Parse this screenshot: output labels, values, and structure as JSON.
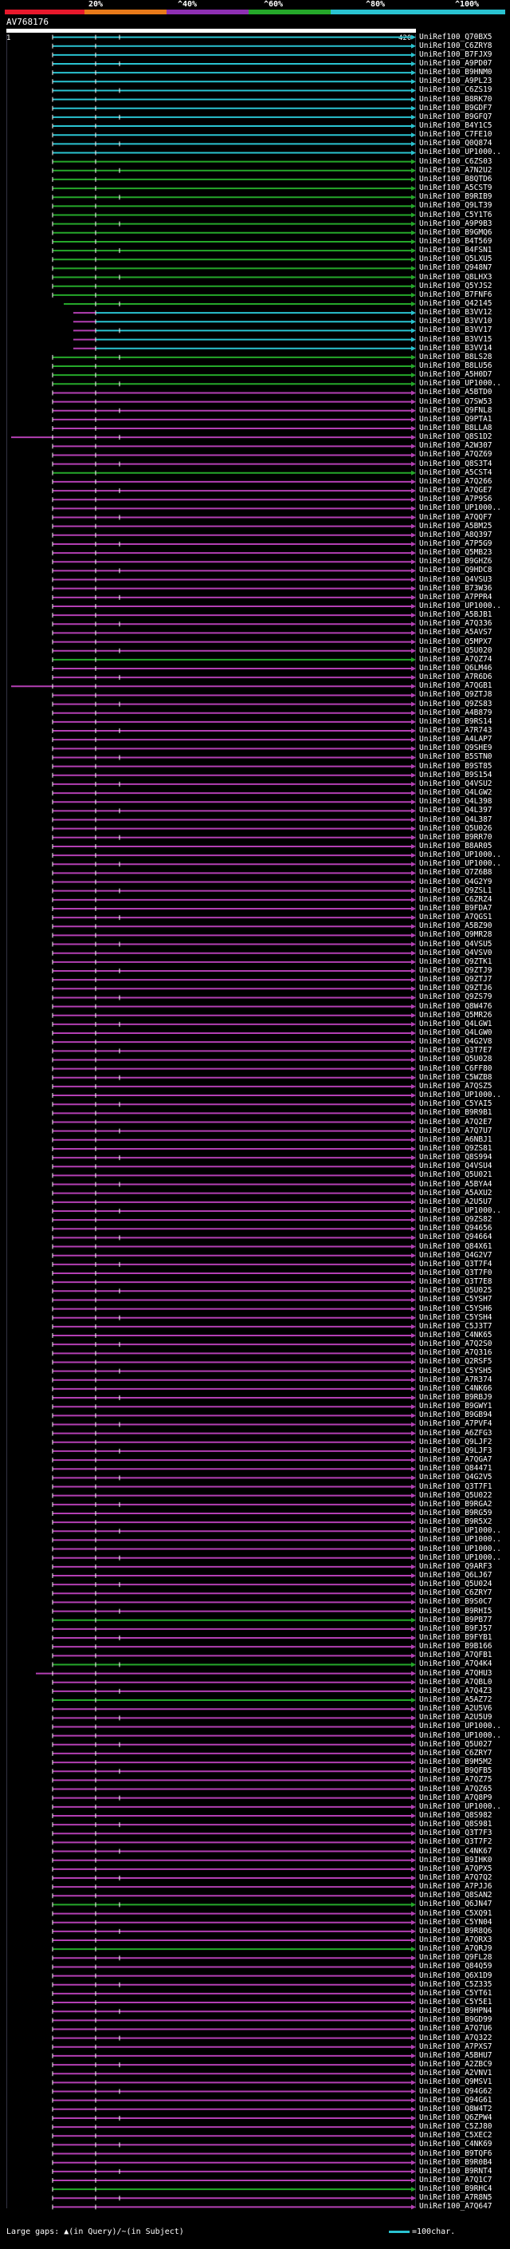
{
  "scale": {
    "ticks": [
      "20%",
      "^40%",
      "^60%",
      "^80%",
      "^100%"
    ],
    "colors": [
      "#e8192c",
      "#e87a1a",
      "#8e2fb3",
      "#25a82a",
      "#2ac3d1"
    ]
  },
  "query": {
    "name": "AV768176",
    "start": "1",
    "end": "420"
  },
  "legend": {
    "text": "Large gaps: ",
    "tri_sym": "▲",
    "in_query": "(in Query)",
    "sep": "/",
    "in_subject": "~(in Subject)",
    "right_label": "=100char."
  },
  "colors": {
    "cyan": "#2ac3d1",
    "green": "#25a82a",
    "purple": "#b33fb3",
    "white": "#ffffff"
  },
  "hits": [
    "UniRef100_Q70BX5",
    "UniRef100_C6ZRY8",
    "UniRef100_B7FJX9",
    "UniRef100_A9PD07",
    "UniRef100_B9HNM0",
    "UniRef100_A9PL23",
    "UniRef100_C6ZS19",
    "UniRef100_B8RK70",
    "UniRef100_B9GDF7",
    "UniRef100_B9GFQ7",
    "UniRef100_B4Y1C5",
    "UniRef100_C7FE10",
    "UniRef100_Q0Q874",
    "UniRef100_UP1000..",
    "UniRef100_C6ZS03",
    "UniRef100_A7N2U2",
    "UniRef100_B8QTD6",
    "UniRef100_A5CST9",
    "UniRef100_B9RIB9",
    "UniRef100_Q9LT39",
    "UniRef100_C5Y1T6",
    "UniRef100_A9P9B3",
    "UniRef100_B9GMQ6",
    "UniRef100_B4T569",
    "UniRef100_B4FSN1",
    "UniRef100_Q5LXU5",
    "UniRef100_Q948N7",
    "UniRef100_Q8LHX3",
    "UniRef100_Q5YJS2",
    "UniRef100_B7FNF6",
    "UniRef100_Q42145",
    "UniRef100_B3VV12",
    "UniRef100_B3VV10",
    "UniRef100_B3VV17",
    "UniRef100_B3VV15",
    "UniRef100_B3VV14",
    "UniRef100_B8LS28",
    "UniRef100_B8LU56",
    "UniRef100_A5H0D7",
    "UniRef100_UP1000..",
    "UniRef100_A5BTD0",
    "UniRef100_Q7SW53",
    "UniRef100_Q9FNL8",
    "UniRef100_Q9PTA1",
    "UniRef100_B8LLA8",
    "UniRef100_Q8S1D2",
    "UniRef100_A2W307",
    "UniRef100_A7QZ69",
    "UniRef100_Q8S3T4",
    "UniRef100_A5CST4",
    "UniRef100_A7Q266",
    "UniRef100_A7QGE7",
    "UniRef100_A7P9S6",
    "UniRef100_UP1000..",
    "UniRef100_A7QQF7",
    "UniRef100_A5BM25",
    "UniRef100_A8Q397",
    "UniRef100_A7P5G9",
    "UniRef100_Q5MB23",
    "UniRef100_B9GHZ6",
    "UniRef100_Q9HDC8",
    "UniRef100_Q4VSU3",
    "UniRef100_B73W36",
    "UniRef100_A7PPR4",
    "UniRef100_UP1000..",
    "UniRef100_A5BJB1",
    "UniRef100_A7Q336",
    "UniRef100_A5AVS7",
    "UniRef100_Q5MPX7",
    "UniRef100_Q5U020",
    "UniRef100_A7QZ74",
    "UniRef100_Q6LM46",
    "UniRef100_A7R6D6",
    "UniRef100_A7QGB1",
    "UniRef100_Q9ZTJ8",
    "UniRef100_Q9ZS83",
    "UniRef100_A4B879",
    "UniRef100_B9RS14",
    "UniRef100_A7R743",
    "UniRef100_A4LAP7",
    "UniRef100_Q9SHE9",
    "UniRef100_B5STN0",
    "UniRef100_B9ST85",
    "UniRef100_B9S154",
    "UniRef100_Q4VSU2",
    "UniRef100_Q4LGW2",
    "UniRef100_Q4L398",
    "UniRef100_Q4L397",
    "UniRef100_Q4L387",
    "UniRef100_Q5U026",
    "UniRef100_B9RR70",
    "UniRef100_B8AR05",
    "UniRef100_UP1000..",
    "UniRef100_UP1000..",
    "UniRef100_Q7Z6B8",
    "UniRef100_Q4G2Y9",
    "UniRef100_Q9ZSL1",
    "UniRef100_C6ZRZ4",
    "UniRef100_B9FDA7",
    "UniRef100_A7QGS1",
    "UniRef100_A5BZ90",
    "UniRef100_Q9MR28",
    "UniRef100_Q4VSU5",
    "UniRef100_Q4VSV0",
    "UniRef100_Q9ZTK1",
    "UniRef100_Q9ZTJ9",
    "UniRef100_Q9ZTJ7",
    "UniRef100_Q9ZTJ6",
    "UniRef100_Q9ZS79",
    "UniRef100_Q8W476",
    "UniRef100_Q5MR26",
    "UniRef100_Q4LGW1",
    "UniRef100_Q4LGW0",
    "UniRef100_Q4G2V8",
    "UniRef100_Q3T7E7",
    "UniRef100_Q5U028",
    "UniRef100_C6FF80",
    "UniRef100_C5WZB8",
    "UniRef100_A7QSZ5",
    "UniRef100_UP1000..",
    "UniRef100_C5YAI5",
    "UniRef100_B9R9B1",
    "UniRef100_A7Q2E7",
    "UniRef100_A7Q7U7",
    "UniRef100_A6NBJ1",
    "UniRef100_Q9ZS81",
    "UniRef100_Q8S994",
    "UniRef100_Q4VSU4",
    "UniRef100_Q5U021",
    "UniRef100_A5BYA4",
    "UniRef100_A5AXU2",
    "UniRef100_A2U5U7",
    "UniRef100_UP1000..",
    "UniRef100_Q9ZS82",
    "UniRef100_Q94656",
    "UniRef100_Q94664",
    "UniRef100_Q84X61",
    "UniRef100_Q4G2V7",
    "UniRef100_Q3T7F4",
    "UniRef100_Q3T7F0",
    "UniRef100_Q3T7E8",
    "UniRef100_Q5U025",
    "UniRef100_C5YSH7",
    "UniRef100_C5YSH6",
    "UniRef100_C5YSH4",
    "UniRef100_C5J3T7",
    "UniRef100_C4NK65",
    "UniRef100_A7Q2S0",
    "UniRef100_A7Q316",
    "UniRef100_Q2RSF5",
    "UniRef100_C5YSH5",
    "UniRef100_A7R374",
    "UniRef100_C4NK66",
    "UniRef100_B9RBJ9",
    "UniRef100_B9GWY1",
    "UniRef100_B9GB94",
    "UniRef100_A7PVF4",
    "UniRef100_A6ZFG3",
    "UniRef100_Q9LJF2",
    "UniRef100_Q9LJF3",
    "UniRef100_A7QGA7",
    "UniRef100_Q84471",
    "UniRef100_Q4G2V5",
    "UniRef100_Q3T7F1",
    "UniRef100_Q5U022",
    "UniRef100_B9RGA2",
    "UniRef100_B9RG59",
    "UniRef100_B9R5X2",
    "UniRef100_UP1000..",
    "UniRef100_UP1000..",
    "UniRef100_UP1000..",
    "UniRef100_UP1000..",
    "UniRef100_Q9ARF3",
    "UniRef100_Q6LJ67",
    "UniRef100_Q5U024",
    "UniRef100_C6ZRY7",
    "UniRef100_B9S0C7",
    "UniRef100_B9RHI5",
    "UniRef100_B9PB77",
    "UniRef100_B9FJ57",
    "UniRef100_B9FYB1",
    "UniRef100_B9B166",
    "UniRef100_A7QFB1",
    "UniRef100_A7Q4K4",
    "UniRef100_A7QHU3",
    "UniRef100_A7QBL0",
    "UniRef100_A7Q4Z3",
    "UniRef100_A5AZ72",
    "UniRef100_A2U5V6",
    "UniRef100_A2U5U9",
    "UniRef100_UP1000..",
    "UniRef100_UP1000..",
    "UniRef100_Q5U027",
    "UniRef100_C6ZRY7",
    "UniRef100_B9M5M2",
    "UniRef100_B9QFB5",
    "UniRef100_A7QZ75",
    "UniRef100_A7QZ65",
    "UniRef100_A7Q8P9",
    "UniRef100_UP1000..",
    "UniRef100_Q8S982",
    "UniRef100_Q8S981",
    "UniRef100_Q3T7F3",
    "UniRef100_Q3T7F2",
    "UniRef100_C4NK67",
    "UniRef100_B9IHK0",
    "UniRef100_A7QPX5",
    "UniRef100_A7Q7Q2",
    "UniRef100_A7PJJ6",
    "UniRef100_Q8SAN2",
    "UniRef100_Q6JN47",
    "UniRef100_C5XQ91",
    "UniRef100_C5YN04",
    "UniRef100_B9R8Q6",
    "UniRef100_A7QRX3",
    "UniRef100_A7QRJ9",
    "UniRef100_Q9FL28",
    "UniRef100_Q84Q59",
    "UniRef100_Q6X1D9",
    "UniRef100_C5Z335",
    "UniRef100_C5YT61",
    "UniRef100_C5Y5E1",
    "UniRef100_B9HPN4",
    "UniRef100_B9GD99",
    "UniRef100_A7Q7U6",
    "UniRef100_A7Q322",
    "UniRef100_A7PXS7",
    "UniRef100_A5BHU7",
    "UniRef100_A2ZBC9",
    "UniRef100_A2VNV1",
    "UniRef100_Q9MSV1",
    "UniRef100_Q94G62",
    "UniRef100_Q94G61",
    "UniRef100_Q8W4T2",
    "UniRef100_Q6ZPW4",
    "UniRef100_C5ZJ80",
    "UniRef100_C5XEC2",
    "UniRef100_C4NK69",
    "UniRef100_B9TQF6",
    "UniRef100_B9R0B4",
    "UniRef100_B9RNT4",
    "UniRef100_A7Q1C7",
    "UniRef100_B9RHC4",
    "UniRef100_A7R8N5",
    "UniRef100_A7Q647"
  ]
}
